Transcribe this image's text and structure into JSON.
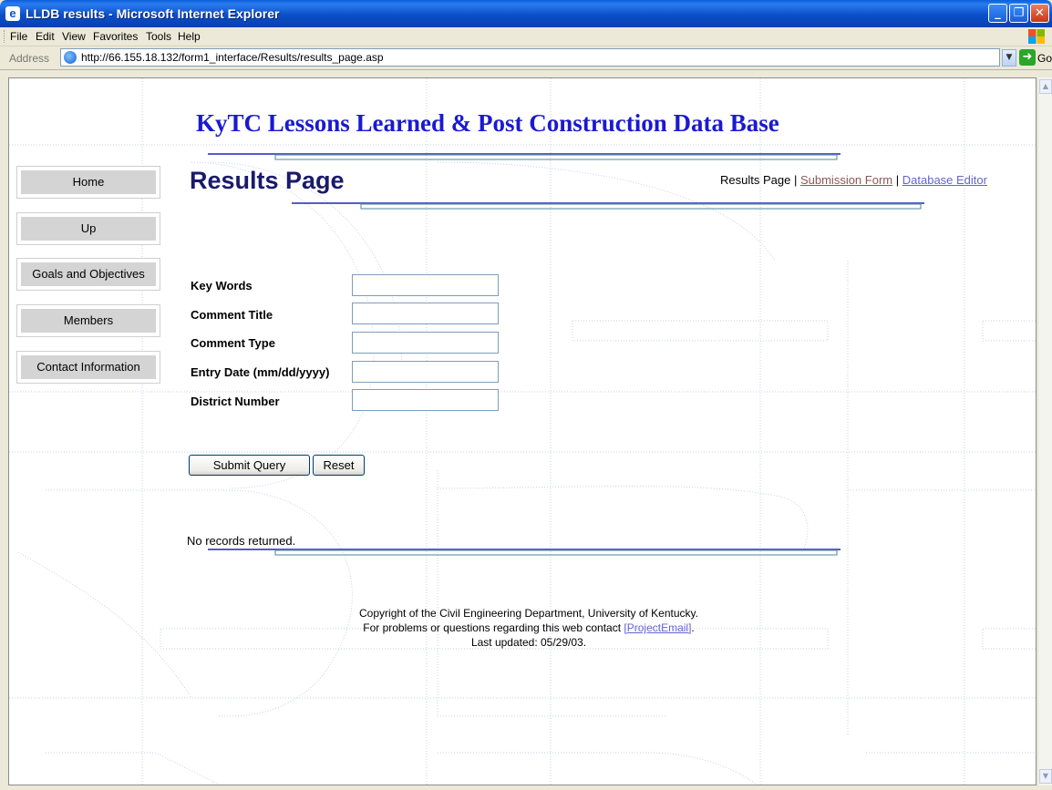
{
  "window": {
    "title": "LLDB results - Microsoft Internet Explorer"
  },
  "menu": [
    "File",
    "Edit",
    "View",
    "Favorites",
    "Tools",
    "Help"
  ],
  "address_bar": {
    "label": "Address",
    "url": "http://66.155.18.132/form1_interface/Results/results_page.asp",
    "go_label": "Go"
  },
  "page": {
    "site_title": "KyTC Lessons Learned & Post Construction Data Base",
    "heading": "Results Page",
    "top_nav": {
      "current": "Results Page",
      "separator": "|",
      "submission_form": "Submission Form",
      "database_editor": "Database Editor"
    },
    "side_nav": [
      "Home",
      "Up",
      "Goals and Objectives",
      "Members",
      "Contact Information"
    ],
    "form": {
      "fields": [
        {
          "label": "Key Words",
          "value": ""
        },
        {
          "label": "Comment Title",
          "value": ""
        },
        {
          "label": "Comment Type",
          "value": ""
        },
        {
          "label": "Entry Date (mm/dd/yyyy)",
          "value": ""
        },
        {
          "label": "District Number",
          "value": ""
        }
      ],
      "submit_label": "Submit Query",
      "reset_label": "Reset"
    },
    "result_message": "No records returned.",
    "footer": {
      "line1": "Copyright of the Civil Engineering Department, University of Kentucky.",
      "line2_prefix": "For problems or questions regarding this web contact ",
      "contact_link": "[ProjectEmail]",
      "line2_suffix": ".",
      "line3": "Last updated: 05/29/03."
    }
  },
  "colors": {
    "site_title": "#1a1ad0",
    "heading": "#1a1a6c",
    "link": "#6464d0",
    "visited_link": "#8d5757",
    "rule_line": "#5a5ac8"
  },
  "icons": {
    "window_controls": [
      "minimize-icon",
      "maximize-icon",
      "close-icon"
    ],
    "go": "go-arrow-icon",
    "page": "ie-page-icon"
  }
}
